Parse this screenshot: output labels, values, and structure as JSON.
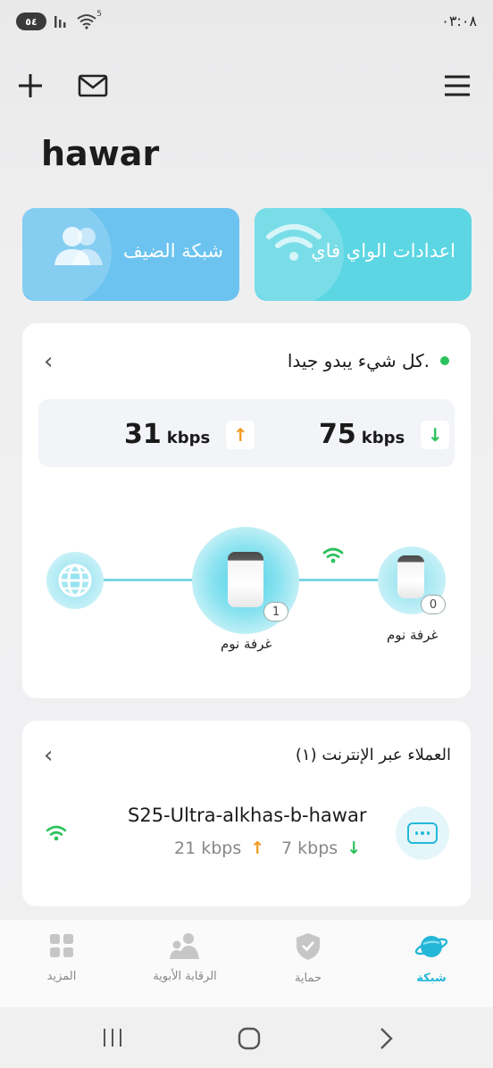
{
  "status_bar": {
    "battery": "٥٤",
    "wifi_badge": "5",
    "time": "٠٣:٠٨"
  },
  "header": {
    "add_icon": "plus-icon",
    "mail_icon": "mail-icon",
    "menu_icon": "menu-icon",
    "site_name": "hawar"
  },
  "quick_cards": {
    "guest_network": "شبكة الضيف",
    "wifi_settings": "اعدادات الواي فاي",
    "guest_color": "#6cc3ef",
    "wifi_color": "#5cd6e3"
  },
  "network_status": {
    "message": "كل شيء يبدو جيدا.",
    "status_color": "#2bc25c",
    "download_value": "75",
    "download_unit": "kbps",
    "upload_value": "31",
    "upload_unit": "kbps",
    "download_arrow": "↓",
    "upload_arrow": "↑"
  },
  "topology": {
    "main_node_label": "غرفة نوم",
    "main_node_clients": "1",
    "satellite_label": "غرفة نوم",
    "satellite_clients": "0"
  },
  "clients": {
    "title": "العملاء عبر الإنترنت (١)",
    "device_name": "S25-Ultra-alkhas-b-hawar",
    "upload_speed": "21 kbps",
    "download_speed": "7 kbps"
  },
  "bottom_nav": {
    "network": "شبكة",
    "security": "حماية",
    "parental": "الرقابة الأبوية",
    "more": "المزيد",
    "active_color": "#25b7d8"
  }
}
